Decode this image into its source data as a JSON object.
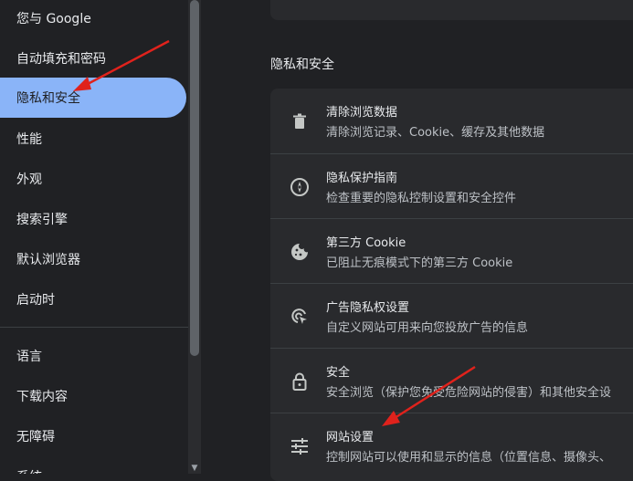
{
  "sidebar": {
    "items": [
      {
        "label": "您与 Google"
      },
      {
        "label": "自动填充和密码"
      },
      {
        "label": "隐私和安全",
        "active": true
      },
      {
        "label": "性能"
      },
      {
        "label": "外观"
      },
      {
        "label": "搜索引擎"
      },
      {
        "label": "默认浏览器"
      },
      {
        "label": "启动时"
      },
      {
        "label": "语言"
      },
      {
        "label": "下载内容"
      },
      {
        "label": "无障碍"
      },
      {
        "label": "系统"
      }
    ]
  },
  "main": {
    "section_title": "隐私和安全",
    "rows": [
      {
        "icon": "trash-icon",
        "title": "清除浏览数据",
        "desc": "清除浏览记录、Cookie、缓存及其他数据"
      },
      {
        "icon": "compass-icon",
        "title": "隐私保护指南",
        "desc": "检查重要的隐私控制设置和安全控件"
      },
      {
        "icon": "cookie-icon",
        "title": "第三方 Cookie",
        "desc": "已阻止无痕模式下的第三方 Cookie"
      },
      {
        "icon": "ad-privacy-icon",
        "title": "广告隐私权设置",
        "desc": "自定义网站可用来向您投放广告的信息"
      },
      {
        "icon": "lock-icon",
        "title": "安全",
        "desc": "安全浏览（保护您免受危险网站的侵害）和其他安全设"
      },
      {
        "icon": "sliders-icon",
        "title": "网站设置",
        "desc": "控制网站可以使用和显示的信息（位置信息、摄像头、"
      }
    ]
  },
  "colors": {
    "background": "#202124",
    "card": "#292a2d",
    "accent": "#8ab4f8",
    "annotation_arrow": "#e0221c"
  }
}
